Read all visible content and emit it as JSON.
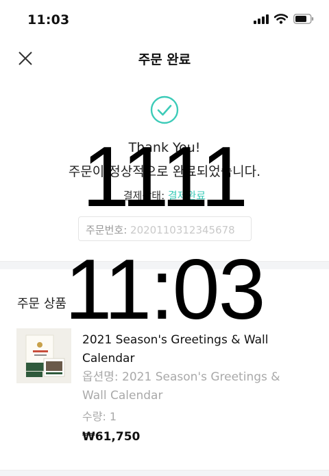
{
  "status_bar": {
    "time": "11:03"
  },
  "nav": {
    "title": "주문 완료"
  },
  "confirmation": {
    "thanks": "Thank You!",
    "message": "주문이 정상적으로 완료되었습니다.",
    "pay_label": "결제상태: ",
    "pay_value": "결제완료",
    "order_label": "주문번호: ",
    "order_value": "2020110312345678"
  },
  "section": {
    "title": "주문 상품"
  },
  "product": {
    "name": "2021 Season's Greetings & Wall Calendar",
    "option": "옵션명: 2021 Season's Greetings & Wall Calendar",
    "qty": "수량: 1",
    "price": "₩61,750"
  },
  "overlay": {
    "line1": "1111",
    "line2": "11:03"
  },
  "colors": {
    "accent": "#3ccbb8",
    "muted": "#a9a9a9",
    "thumb_green": "#2f5a3c"
  }
}
